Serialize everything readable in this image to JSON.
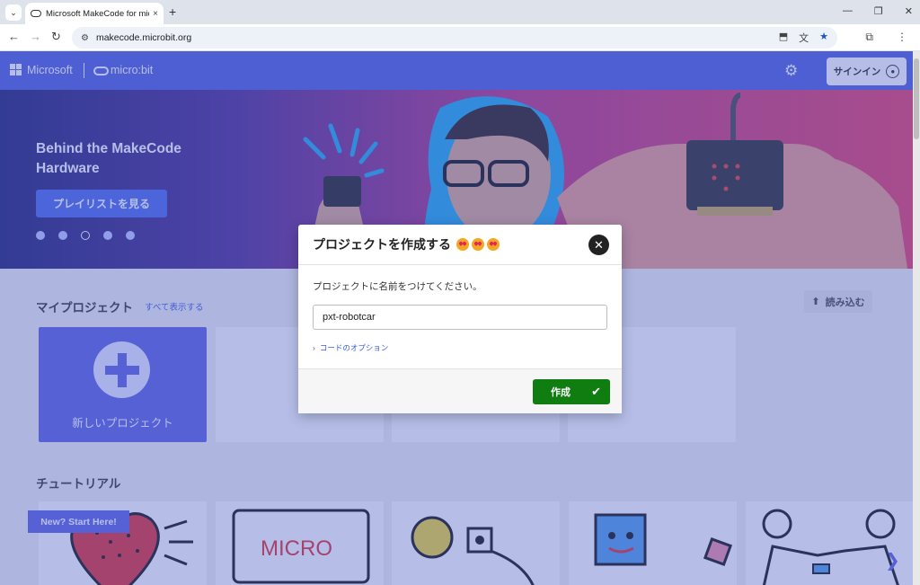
{
  "browser": {
    "tab_title": "Microsoft MakeCode for micro:",
    "url": "makecode.microbit.org",
    "tab_close": "×",
    "new_tab": "+",
    "back": "←",
    "forward": "→",
    "reload": "↻"
  },
  "header": {
    "brand": "Microsoft",
    "product": "micro:bit",
    "signin_label": "サインイン",
    "settings_icon": "gear-icon"
  },
  "hero": {
    "title": "Behind the MakeCode Hardware",
    "button_label": "プレイリストを見る",
    "slide_count": 5,
    "active_slide": 3
  },
  "my_projects": {
    "title": "マイプロジェクト",
    "see_all": "すべて表示する",
    "import_label": "読み込む",
    "new_project_label": "新しいプロジェクト"
  },
  "tutorials": {
    "title": "チュートリアル",
    "badge": "New? Start Here!",
    "card_labels": [
      "MICRO"
    ]
  },
  "modal": {
    "title": "プロジェクトを作成する",
    "prompt": "プロジェクトに名前をつけてください。",
    "name_value": "pxt-robotcar",
    "code_options": "コードのオプション",
    "create_label": "作成",
    "close_icon": "close-icon"
  },
  "colors": {
    "header": "#4c5cdb",
    "accent": "#5b60e0",
    "create": "#0f7d10"
  }
}
